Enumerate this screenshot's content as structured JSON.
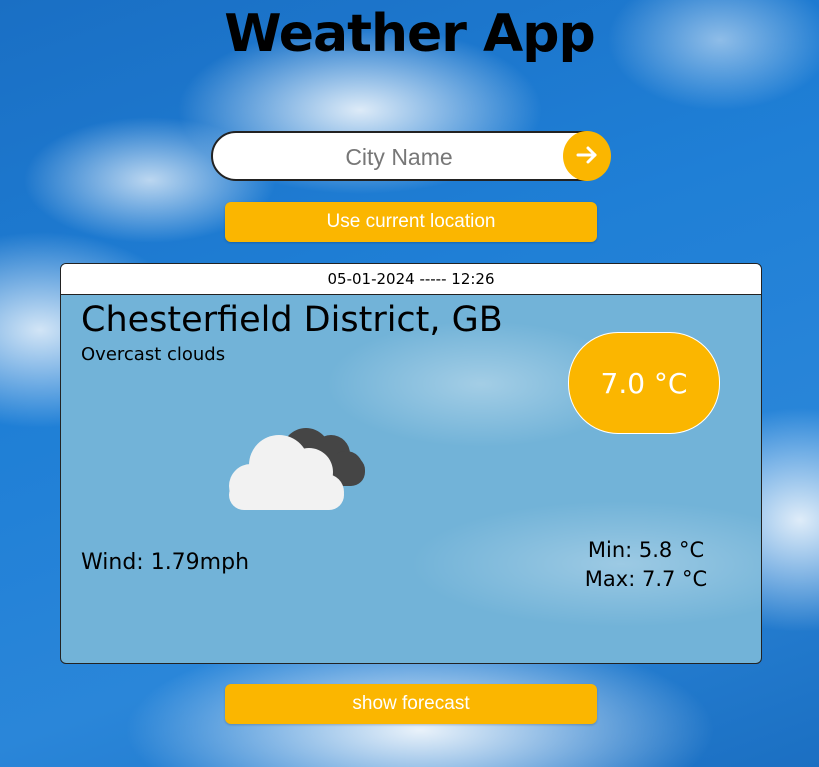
{
  "app": {
    "title": "Weather App"
  },
  "search": {
    "placeholder": "City Name",
    "value": "",
    "submit_icon": "arrow-right-icon"
  },
  "buttons": {
    "current_location": "Use current location",
    "show_forecast": "show forecast"
  },
  "weather": {
    "datetime": "05-01-2024 ----- 12:26",
    "location": "Chesterfield District, GB",
    "description": "Overcast clouds",
    "icon": "overcast-clouds-icon",
    "temperature": "7.0 °C",
    "wind": "Wind: 1.79mph",
    "min": "Min: 5.8 °C",
    "max": "Max: 7.7 °C"
  },
  "colors": {
    "accent": "#fbb600",
    "card_background": "#72b3d8",
    "sky": "#1f7fd6"
  }
}
